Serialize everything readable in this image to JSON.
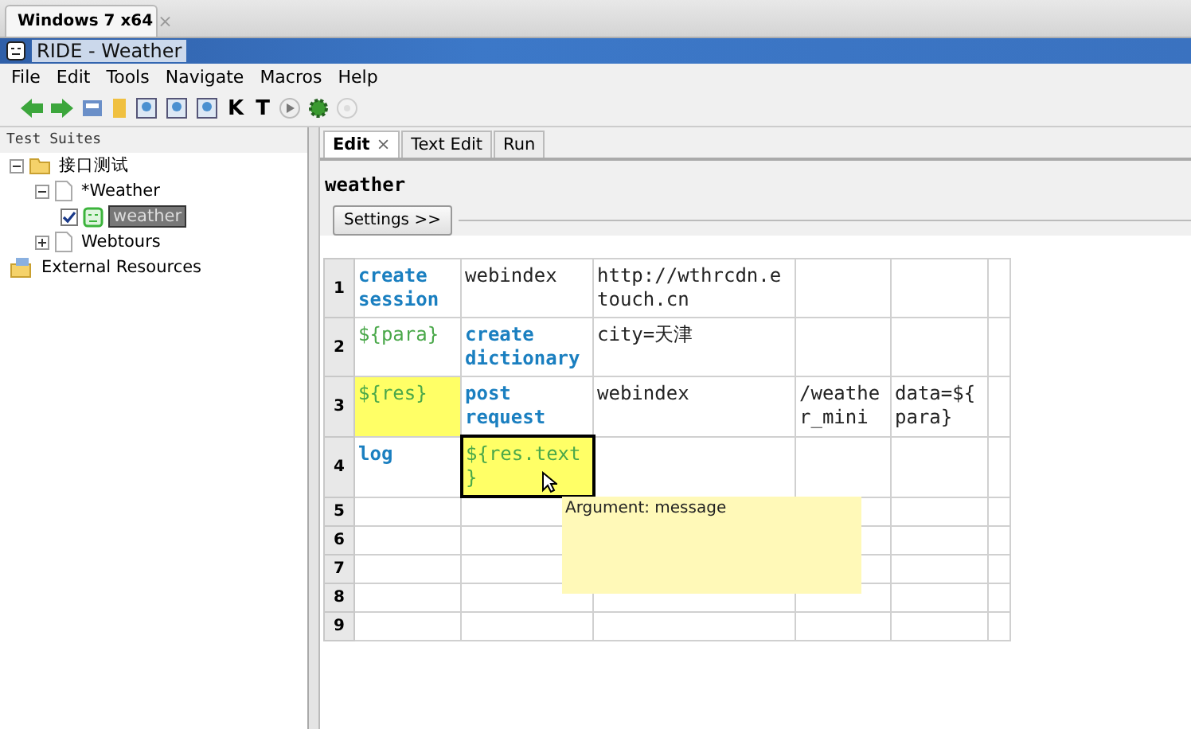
{
  "host_tab": {
    "label": "Windows 7 x64",
    "close": "×"
  },
  "window": {
    "title": "RIDE - Weather"
  },
  "menu": [
    "File",
    "Edit",
    "Tools",
    "Navigate",
    "Macros",
    "Help"
  ],
  "toolbar": [
    {
      "kind": "back"
    },
    {
      "kind": "forward"
    },
    {
      "kind": "open"
    },
    {
      "kind": "folder"
    },
    {
      "kind": "doc"
    },
    {
      "kind": "doc"
    },
    {
      "kind": "doc"
    },
    {
      "kind": "letter",
      "text": "K"
    },
    {
      "kind": "letter",
      "text": "T"
    },
    {
      "kind": "play"
    },
    {
      "kind": "gear"
    },
    {
      "kind": "stop"
    }
  ],
  "tree": {
    "title": "Test Suites",
    "items": [
      {
        "label": "接口测试",
        "kind": "folder",
        "expanded": true,
        "children": [
          {
            "label": "*Weather",
            "kind": "file",
            "expanded": true,
            "children": [
              {
                "label": "weather",
                "kind": "test",
                "checked": true,
                "selected": true
              }
            ]
          },
          {
            "label": "Webtours",
            "kind": "file",
            "expanded": false
          }
        ]
      },
      {
        "label": "External Resources",
        "kind": "resources"
      }
    ]
  },
  "tabs": [
    {
      "label": "Edit",
      "selected": true,
      "close": "×"
    },
    {
      "label": "Text Edit",
      "selected": false
    },
    {
      "label": "Run",
      "selected": false
    }
  ],
  "test_name": "weather",
  "settings_button": "Settings >>",
  "grid": {
    "rows": [
      {
        "number": "1",
        "cells": [
          {
            "text": "create session",
            "kind": "keyword",
            "highlighted": false,
            "selected": false
          },
          {
            "text": "webindex",
            "kind": "plain",
            "highlighted": false,
            "selected": false
          },
          {
            "text": "http://wthrcdn.etouch.cn",
            "kind": "plain",
            "highlighted": false,
            "selected": false
          },
          {
            "highlighted": false,
            "selected": false
          },
          {
            "highlighted": false,
            "selected": false
          },
          {
            "highlighted": false,
            "selected": false
          }
        ]
      },
      {
        "number": "2",
        "cells": [
          {
            "text": "${para}",
            "kind": "variable",
            "highlighted": false,
            "selected": false
          },
          {
            "text": "create dictionary",
            "kind": "keyword",
            "highlighted": false,
            "selected": false
          },
          {
            "text": "city=天津",
            "kind": "plain",
            "highlighted": false,
            "selected": false
          },
          {
            "highlighted": false,
            "selected": false
          },
          {
            "highlighted": false,
            "selected": false
          },
          {
            "highlighted": false,
            "selected": false
          }
        ]
      },
      {
        "number": "3",
        "cells": [
          {
            "text": "${res}",
            "kind": "variable",
            "highlighted": true,
            "selected": false
          },
          {
            "text": "post request",
            "kind": "keyword",
            "highlighted": false,
            "selected": false
          },
          {
            "text": "webindex",
            "kind": "plain",
            "highlighted": false,
            "selected": false
          },
          {
            "text": "/weather_mini",
            "kind": "plain",
            "highlighted": false,
            "selected": false
          },
          {
            "text": "data=${para}",
            "kind": "plain",
            "highlighted": false,
            "selected": false
          },
          {
            "highlighted": false,
            "selected": false
          }
        ]
      },
      {
        "number": "4",
        "cells": [
          {
            "text": "log",
            "kind": "keyword",
            "highlighted": false,
            "selected": false
          },
          {
            "text": "${res.text}",
            "kind": "variable",
            "highlighted": true,
            "selected": true
          },
          {
            "highlighted": false,
            "selected": false
          },
          {
            "highlighted": false,
            "selected": false
          },
          {
            "highlighted": false,
            "selected": false
          },
          {
            "highlighted": false,
            "selected": false
          }
        ]
      },
      {
        "number": "5"
      },
      {
        "number": "6"
      },
      {
        "number": "7"
      },
      {
        "number": "8"
      },
      {
        "number": "9"
      }
    ]
  },
  "tooltip": {
    "text": "Argument: message"
  }
}
